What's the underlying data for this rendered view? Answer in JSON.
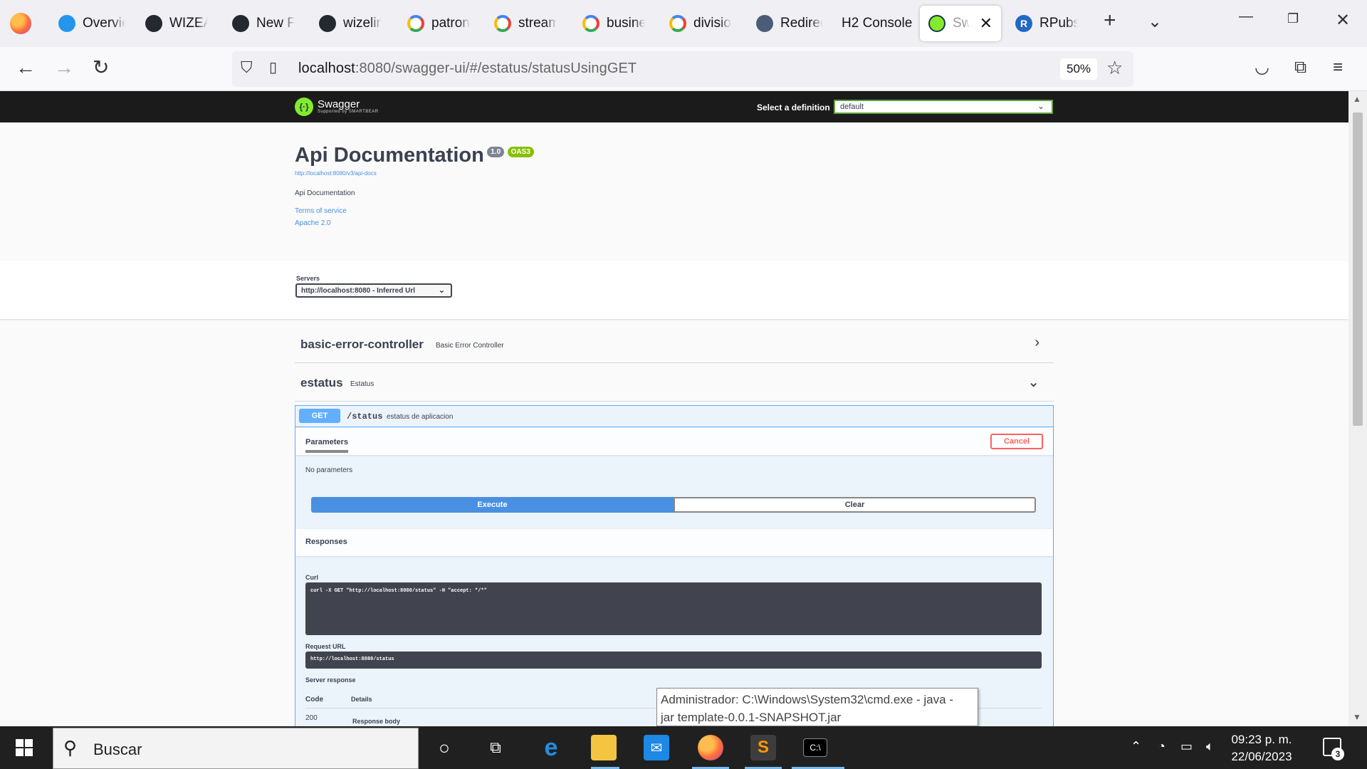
{
  "browser": {
    "tabs": [
      {
        "label": "Overvie",
        "icon": "docker-icon"
      },
      {
        "label": "WIZEA",
        "icon": "github-icon"
      },
      {
        "label": "New Fil",
        "icon": "github-icon"
      },
      {
        "label": "wizelin",
        "icon": "github-icon"
      },
      {
        "label": "patron",
        "icon": "google-icon"
      },
      {
        "label": "stream",
        "icon": "google-icon"
      },
      {
        "label": "busine",
        "icon": "google-icon"
      },
      {
        "label": "divisio",
        "icon": "google-icon"
      },
      {
        "label": "Redirec",
        "icon": "redirect-icon"
      },
      {
        "label": "H2 Console",
        "icon": ""
      },
      {
        "label": "Swa",
        "icon": "swagger-icon",
        "active": true
      },
      {
        "label": "RPubs",
        "icon": "rpubs-icon"
      }
    ],
    "url_host": "localhost",
    "url_rest": ":8080/swagger-ui/#/estatus/statusUsingGET",
    "zoom": "50%"
  },
  "swagger": {
    "logo_name": "Swagger",
    "logo_sub": "Supported by SMARTBEAR",
    "select_definition_label": "Select a definition",
    "definition_value": "default",
    "title": "Api Documentation",
    "version": "1.0",
    "oas": "OAS3",
    "api_docs_url": "http://localhost:8080/v3/api-docs",
    "description": "Api Documentation",
    "terms": "Terms of service",
    "license": "Apache 2.0",
    "servers_label": "Servers",
    "server_value": "http://localhost:8080 - Inferred Url",
    "tags": [
      {
        "name": "basic-error-controller",
        "description": "Basic Error Controller",
        "expanded": false
      },
      {
        "name": "estatus",
        "description": "Estatus",
        "expanded": true
      }
    ],
    "operation": {
      "method": "GET",
      "path": "/status",
      "summary": "estatus de aplicacion",
      "parameters_tab": "Parameters",
      "cancel": "Cancel",
      "no_params": "No parameters",
      "execute": "Execute",
      "clear": "Clear",
      "responses_title": "Responses",
      "curl_label": "Curl",
      "curl": "curl -X GET \"http://localhost:8080/status\" -H \"accept: */*\"",
      "request_url_label": "Request URL",
      "request_url": "http://localhost:8080/status",
      "server_response_label": "Server response",
      "col_code": "Code",
      "col_details": "Details",
      "response_code": "200",
      "response_body_label": "Response body"
    }
  },
  "tooltip": {
    "line1": "Administrador: C:\\Windows\\System32\\cmd.exe - java  -",
    "line2": "jar template-0.0.1-SNAPSHOT.jar"
  },
  "taskbar": {
    "search_placeholder": "Buscar",
    "time": "09:23 p. m.",
    "date": "22/06/2023",
    "notifications": "3"
  },
  "colors": {
    "get_method": "#61affe",
    "execute": "#4990e2",
    "cancel": "#ff6060",
    "swagger_green": "#85ea2d"
  }
}
